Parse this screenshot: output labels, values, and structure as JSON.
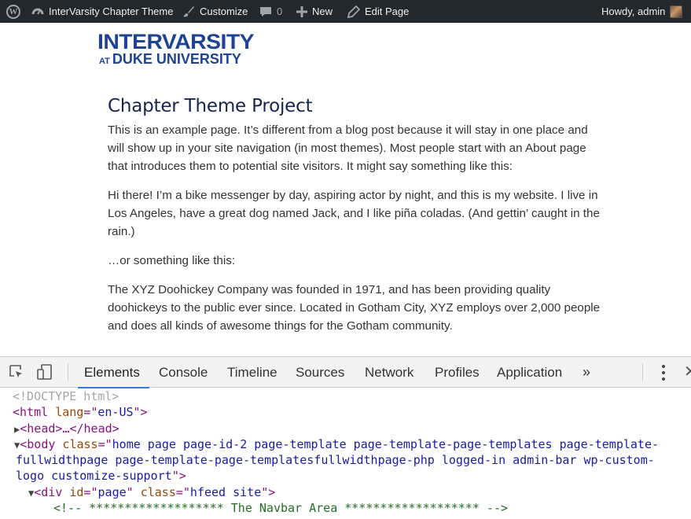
{
  "admin_bar": {
    "site_name": "InterVarsity Chapter Theme",
    "customize": "Customize",
    "comments_count": "0",
    "new": "New",
    "edit_page": "Edit Page",
    "howdy": "Howdy, admin"
  },
  "logo": {
    "line1": "INTERVARSITY",
    "line2_prefix": "AT",
    "line2": "DUKE UNIVERSITY"
  },
  "page": {
    "title": "Chapter Theme Project",
    "paragraphs": [
      "This is an example page. It’s different from a blog post because it will stay in one place and will show up in your site navigation (in most themes). Most people start with an About page that introduces them to potential site visitors. It might say something like this:",
      "Hi there! I’m a bike messenger by day, aspiring actor by night, and this is my website. I live in Los Angeles, have a great dog named Jack, and I like piña coladas. (And gettin’ caught in the rain.)",
      "…or something like this:",
      "The XYZ Doohickey Company was founded in 1971, and has been providing quality doohickeys to the public ever since. Located in Gotham City, XYZ employs over 2,000 people and does all kinds of awesome things for the Gotham community."
    ]
  },
  "devtools": {
    "tabs": [
      "Elements",
      "Console",
      "Timeline",
      "Sources",
      "Network",
      "Profiles",
      "Application"
    ],
    "active_tab": "Elements",
    "more": "»",
    "dom": {
      "doctype": "<!DOCTYPE html>",
      "html_open": "<html",
      "html_lang_attr": "lang",
      "html_lang_val": "en-US",
      "head": "<head>…</head>",
      "body_open": "<body",
      "body_class_attr": "class",
      "body_class_val_1": "home page page-id-2 page-template page-template-page-templates page-template-",
      "body_class_val_2": "fullwidthpage page-template-page-templatesfullwidthpage-php logged-in admin-bar wp-custom-",
      "body_class_val_3": "logo customize-support",
      "div_open": "<div",
      "div_id_attr": "id",
      "div_id_val": "page",
      "div_class_attr": "class",
      "div_class_val": "hfeed site",
      "comment": "<!-- ******************* The Navbar Area ******************* -->"
    }
  },
  "colors": {
    "admin_bar_bg": "#23282d",
    "logo_blue": "#1f4393",
    "title_navy": "#14264f",
    "devtools_accent": "#3879d9"
  }
}
